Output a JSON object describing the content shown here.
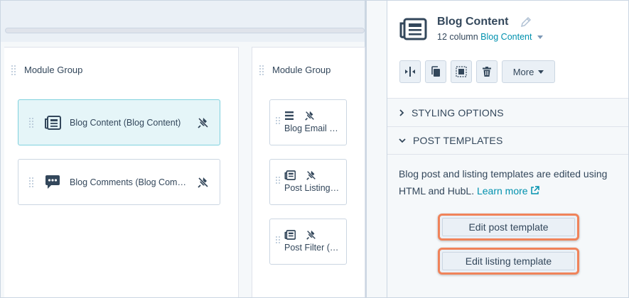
{
  "canvas": {
    "group1_title": "Module Group",
    "group2_title": "Module Group",
    "modules_wide": [
      {
        "label": "Blog Content (Blog Content)",
        "icon": "newspaper-icon",
        "selected": true
      },
      {
        "label": "Blog Comments (Blog Com…",
        "icon": "chat-bubble-icon",
        "selected": false
      }
    ],
    "modules_small": [
      {
        "label": "Blog Email …",
        "icon": "list-icon"
      },
      {
        "label": "Post Listing…",
        "icon": "newspaper-icon"
      },
      {
        "label": "Post Filter (…",
        "icon": "newspaper-icon"
      }
    ]
  },
  "panel": {
    "title": "Blog Content",
    "subtitle_prefix": "12 column",
    "subtitle_link": "Blog Content",
    "toolbar": {
      "more_label": "More"
    },
    "sections": {
      "styling": "STYLING OPTIONS",
      "post_templates": "POST TEMPLATES"
    },
    "description": "Blog post and listing templates are edited using HTML and HubL.",
    "learn_more": "Learn more",
    "edit_post_template": "Edit post template",
    "edit_listing_template": "Edit listing template"
  },
  "colors": {
    "accent": "#0091ae",
    "highlight_outline": "#f0835a",
    "selected_bg": "#e5f5f8",
    "text": "#33475b"
  }
}
